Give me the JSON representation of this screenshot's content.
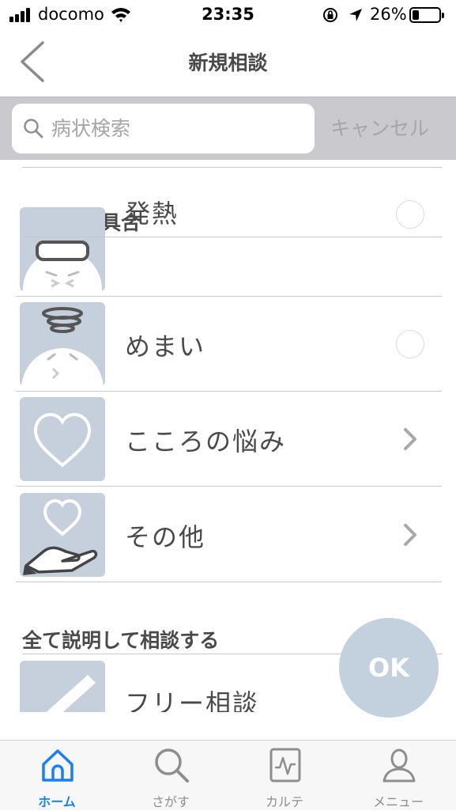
{
  "status_bar": {
    "carrier": "docomo",
    "time": "23:35",
    "battery_percent": "26%",
    "battery_level": 0.26
  },
  "nav": {
    "title": "新規相談",
    "back_icon": "chevron-left-icon"
  },
  "search": {
    "placeholder": "病状検索",
    "value": "",
    "cancel_label": "キャンセル"
  },
  "sections": [
    {
      "header": "全身の不具合"
    },
    {
      "header": "全て説明して相談する"
    }
  ],
  "items": [
    {
      "label": "発熱",
      "icon": "fever-face-icon",
      "accessory": "radio"
    },
    {
      "label": "めまい",
      "icon": "dizzy-face-icon",
      "accessory": "radio"
    },
    {
      "label": "こころの悩み",
      "icon": "heart-icon",
      "accessory": "chevron"
    },
    {
      "label": "その他",
      "icon": "heart-hand-icon",
      "accessory": "chevron"
    },
    {
      "label": "フリー相談",
      "icon": "pencil-icon",
      "accessory": "chevron"
    }
  ],
  "ok_button": {
    "label": "OK"
  },
  "tabs": [
    {
      "label": "ホーム",
      "icon": "home-icon",
      "active": true
    },
    {
      "label": "さがす",
      "icon": "search-icon",
      "active": false
    },
    {
      "label": "カルテ",
      "icon": "chart-record-icon",
      "active": false
    },
    {
      "label": "メニュー",
      "icon": "user-icon",
      "active": false
    }
  ],
  "colors": {
    "accent": "#1a7ff0",
    "thumb_bg": "#c5d0dc",
    "fab_bg": "#c3d0dd",
    "search_bar_bg": "#c9c9ce"
  }
}
